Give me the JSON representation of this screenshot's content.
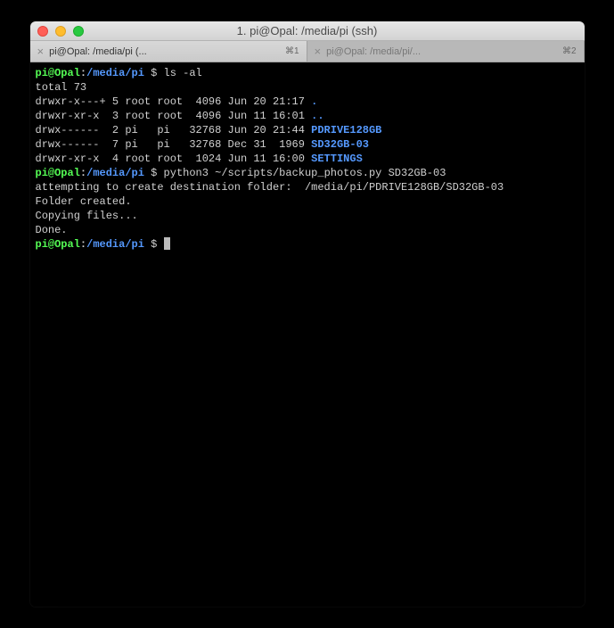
{
  "window": {
    "title": "1. pi@Opal: /media/pi (ssh)"
  },
  "tabs": [
    {
      "label": "pi@Opal: /media/pi (...",
      "shortcut": "⌘1",
      "active": true
    },
    {
      "label": "pi@Opal: /media/pi/...",
      "shortcut": "⌘2",
      "active": false
    }
  ],
  "prompt": {
    "user": "pi@Opal",
    "colon": ":",
    "path": "/media/pi",
    "dollar": " $ "
  },
  "session": {
    "cmd1": "ls -al",
    "out_total": "total 73",
    "ls": [
      {
        "perm": "drwxr-x---+ 5 root root  4096 Jun 20 21:17 ",
        "name": "."
      },
      {
        "perm": "drwxr-xr-x  3 root root  4096 Jun 11 16:01 ",
        "name": ".."
      },
      {
        "perm": "drwx------  2 pi   pi   32768 Jun 20 21:44 ",
        "name": "PDRIVE128GB"
      },
      {
        "perm": "drwx------  7 pi   pi   32768 Dec 31  1969 ",
        "name": "SD32GB-03"
      },
      {
        "perm": "drwxr-xr-x  4 root root  1024 Jun 11 16:00 ",
        "name": "SETTINGS"
      }
    ],
    "cmd2": "python3 ~/scripts/backup_photos.py SD32GB-03",
    "out_attempt": "attempting to create destination folder:  /media/pi/PDRIVE128GB/SD32GB-03",
    "out_created": "Folder created.",
    "out_copying": "Copying files...",
    "out_done": "Done."
  }
}
